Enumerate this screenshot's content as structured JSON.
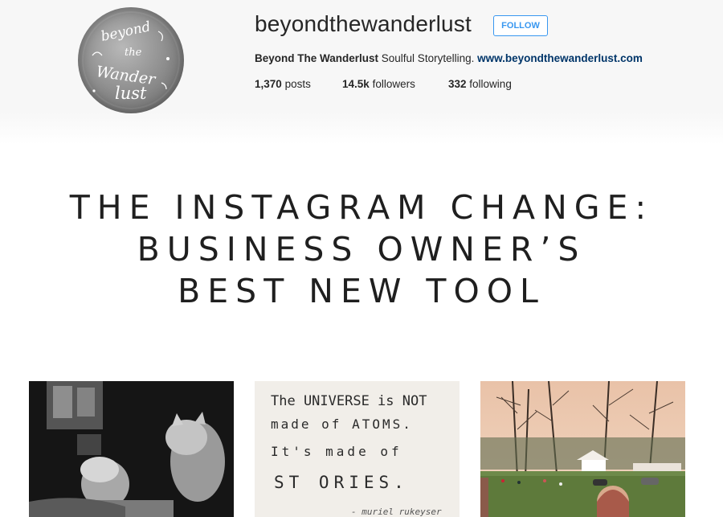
{
  "profile": {
    "username": "beyondthewanderlust",
    "follow_label": "FOLLOW",
    "bio": {
      "name": "Beyond The Wanderlust",
      "tagline": "Soulful Storytelling.",
      "link": "www.beyondthewanderlust.com"
    },
    "stats": [
      {
        "count": "1,370",
        "label": "posts"
      },
      {
        "count": "14.5k",
        "label": "followers"
      },
      {
        "count": "332",
        "label": "following"
      }
    ],
    "avatar_text": "beyond the wander lust"
  },
  "headline": {
    "line1": "THE INSTAGRAM CHANGE:",
    "line2": "BUSINESS OWNER’S",
    "line3": "BEST NEW TOOL"
  },
  "photos": [
    {
      "subject": "child-and-cat-bw"
    },
    {
      "subject": "handwritten-quote",
      "text": [
        "The UNIVERSE is NOT",
        "made of ATOMS.",
        "It's made of",
        "ST ORIES.",
        "- muriel rukeyser"
      ]
    },
    {
      "subject": "suburban-park-sunset"
    }
  ],
  "colors": {
    "accent": "#3897f0",
    "link": "#003569",
    "header_bg": "#f7f7f7",
    "text": "#262626"
  }
}
